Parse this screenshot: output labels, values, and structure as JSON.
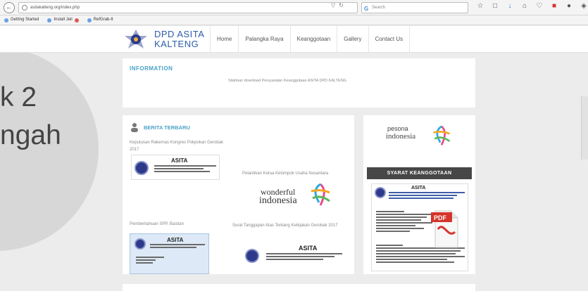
{
  "browser": {
    "url": "asitakalteng.org/index.php",
    "search_placeholder": "Search",
    "bookmarks": [
      "Getting Started",
      "Install Jeil",
      "RefGrab-It"
    ]
  },
  "side_text": "k 2\nngah",
  "site": {
    "brand_line1": "DPD ASITA",
    "brand_line2": "KALTENG",
    "nav": [
      "Home",
      "Palangka Raya",
      "Keanggotaan",
      "Gallery",
      "Contact Us"
    ]
  },
  "information": {
    "title": "INFORMATION",
    "text": "Silahkan download Persyaratan Keanggotaan ASITA DPD KALTENG"
  },
  "berita": {
    "title": "BERITA TERBARU",
    "items": [
      {
        "title": "Keputusan Rakernas Kongres Pokpokan Gerobak 2017"
      },
      {
        "title": "Pelantikan Ketua Kelompok Usaha Nusantara"
      },
      {
        "title": "Pemberitahuan SPP, Bastian"
      },
      {
        "title": "Surat Tanggapan Atas Tentang Kebijakan Gerobak 2017"
      }
    ],
    "logo_wonderful_1": "wonderful",
    "logo_wonderful_2": "indonesia",
    "doc_brand": "ASITA"
  },
  "pesona": {
    "line1": "pesona",
    "line2": "indonesia"
  },
  "syarat": {
    "title": "SYARAT KEANGGOTAAN",
    "doc_brand": "ASITA",
    "pdf_label": "PDF"
  },
  "colors": {
    "accent": "#4aa3c8",
    "brand": "#2b5daa",
    "dark_bar": "#474747",
    "pdf_red": "#d6342a"
  }
}
